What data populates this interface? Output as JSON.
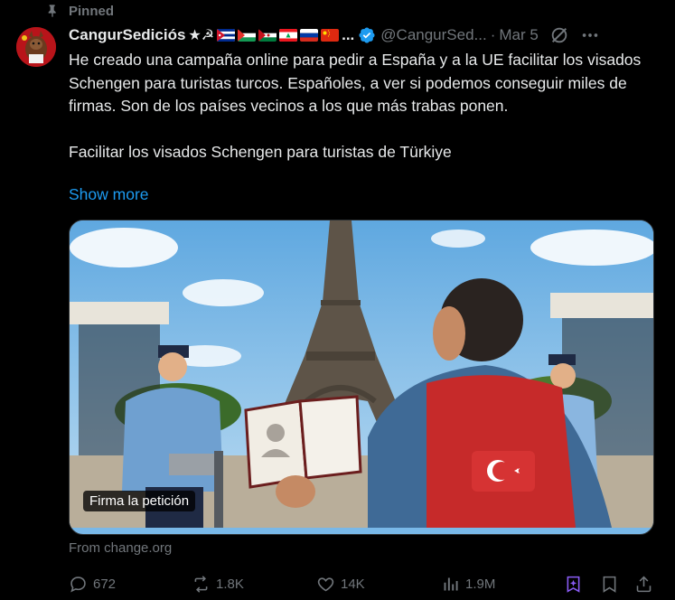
{
  "pinned": {
    "label": "Pinned"
  },
  "author": {
    "display_name": "CangurSediciós",
    "name_suffix": "★☭",
    "flags": [
      "cuba-flag",
      "palestine-flag",
      "sahrawi-flag",
      "lebanon-flag",
      "russia-flag",
      "china-flag"
    ],
    "ellipsis": "...",
    "handle": "@CangurSed...",
    "separator": "·",
    "date": "Mar 5"
  },
  "tweet": {
    "paragraph1": "He creado una campaña online para pedir a España y a la UE facilitar los visados Schengen para turistas turcos. Españoles, a ver si podemos conseguir miles de firmas. Son de los países vecinos a los que más trabas ponen.",
    "paragraph2": "Facilitar los visados Schengen para turistas de Türkiye",
    "show_more": "Show more"
  },
  "card": {
    "label": "Firma la petición",
    "source": "From change.org"
  },
  "actions": {
    "replies": "672",
    "reposts": "1.8K",
    "likes": "14K",
    "views": "1.9M"
  },
  "colors": {
    "background": "#000000",
    "text": "#e7e9ea",
    "muted": "#71767b",
    "link": "#1d9bf0",
    "verified": "#1d9bf0",
    "grok_purple": "#8a5cf6"
  }
}
